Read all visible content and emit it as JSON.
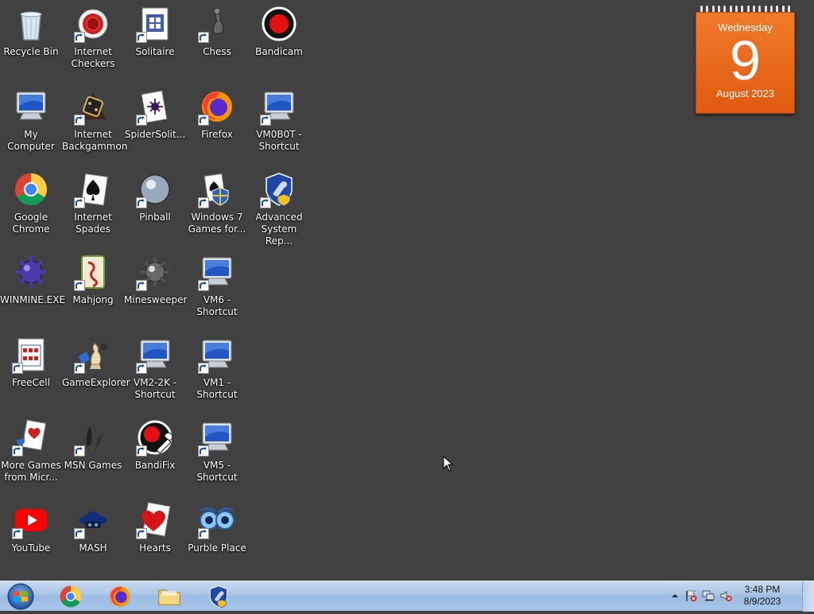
{
  "desktop": {
    "icons": [
      {
        "label": "Recycle Bin",
        "icon": "recycle-bin-icon",
        "shortcut": false
      },
      {
        "label": "Internet\nCheckers",
        "icon": "checkers-icon",
        "shortcut": true
      },
      {
        "label": "Solitaire",
        "icon": "solitaire-icon",
        "shortcut": true
      },
      {
        "label": "Chess",
        "icon": "chess-icon",
        "shortcut": true
      },
      {
        "label": "Bandicam",
        "icon": "bandicam-icon",
        "shortcut": false
      },
      {
        "label": "My Computer",
        "icon": "computer-icon",
        "shortcut": false
      },
      {
        "label": "Internet\nBackgammon",
        "icon": "backgammon-icon",
        "shortcut": true
      },
      {
        "label": "SpiderSolit...",
        "icon": "spider-solitaire-icon",
        "shortcut": true
      },
      {
        "label": "Firefox",
        "icon": "firefox-icon",
        "shortcut": true
      },
      {
        "label": "VM0B0T -\nShortcut",
        "icon": "computer-icon",
        "shortcut": true
      },
      {
        "label": "Google\nChrome",
        "icon": "chrome-icon",
        "shortcut": false
      },
      {
        "label": "Internet\nSpades",
        "icon": "spades-icon",
        "shortcut": true
      },
      {
        "label": "Pinball",
        "icon": "pinball-icon",
        "shortcut": true
      },
      {
        "label": "Windows 7\nGames for...",
        "icon": "windows7-games-icon",
        "shortcut": true
      },
      {
        "label": "Advanced\nSystem Rep...",
        "icon": "shield-icon",
        "shortcut": true
      },
      {
        "label": "WINMINE.EXE",
        "icon": "mine-icon",
        "shortcut": false
      },
      {
        "label": "Mahjong",
        "icon": "mahjong-icon",
        "shortcut": true
      },
      {
        "label": "Minesweeper",
        "icon": "minesweeper-icon",
        "shortcut": true
      },
      {
        "label": "VM6 -\nShortcut",
        "icon": "computer-icon",
        "shortcut": true
      },
      {
        "label": "FreeCell",
        "icon": "freecell-icon",
        "shortcut": true
      },
      {
        "label": "GameExplorer",
        "icon": "game-explorer-icon",
        "shortcut": true
      },
      {
        "label": "VM2-2K -\nShortcut",
        "icon": "computer-icon",
        "shortcut": true
      },
      {
        "label": "VM1 -\nShortcut",
        "icon": "computer-icon",
        "shortcut": true
      },
      {
        "label": "More Games\nfrom Micr...",
        "icon": "more-games-icon",
        "shortcut": true
      },
      {
        "label": "MSN Games",
        "icon": "msn-games-icon",
        "shortcut": true
      },
      {
        "label": "BandiFix",
        "icon": "bandifix-icon",
        "shortcut": true
      },
      {
        "label": "VM5 -\nShortcut",
        "icon": "computer-icon",
        "shortcut": true
      },
      {
        "label": "YouTube",
        "icon": "youtube-icon",
        "shortcut": true
      },
      {
        "label": "MASH",
        "icon": "mash-icon",
        "shortcut": true
      },
      {
        "label": "Hearts",
        "icon": "hearts-icon",
        "shortcut": true
      },
      {
        "label": "Purble Place",
        "icon": "purble-place-icon",
        "shortcut": true
      }
    ]
  },
  "calendar": {
    "weekday": "Wednesday",
    "day": "9",
    "month_year": "August 2023"
  },
  "taskbar": {
    "pinned": [
      {
        "name": "chrome",
        "icon": "chrome-icon"
      },
      {
        "name": "firefox",
        "icon": "firefox-icon"
      },
      {
        "name": "file-explorer",
        "icon": "folder-icon"
      },
      {
        "name": "advanced-system-repair",
        "icon": "shield-icon"
      }
    ],
    "tray": {
      "time": "3:48 PM",
      "date": "8/9/2023"
    }
  },
  "colors": {
    "desktop_bg": "#414141",
    "calendar_orange": "#e8651a",
    "taskbar_blue": "#a9c4e6"
  }
}
